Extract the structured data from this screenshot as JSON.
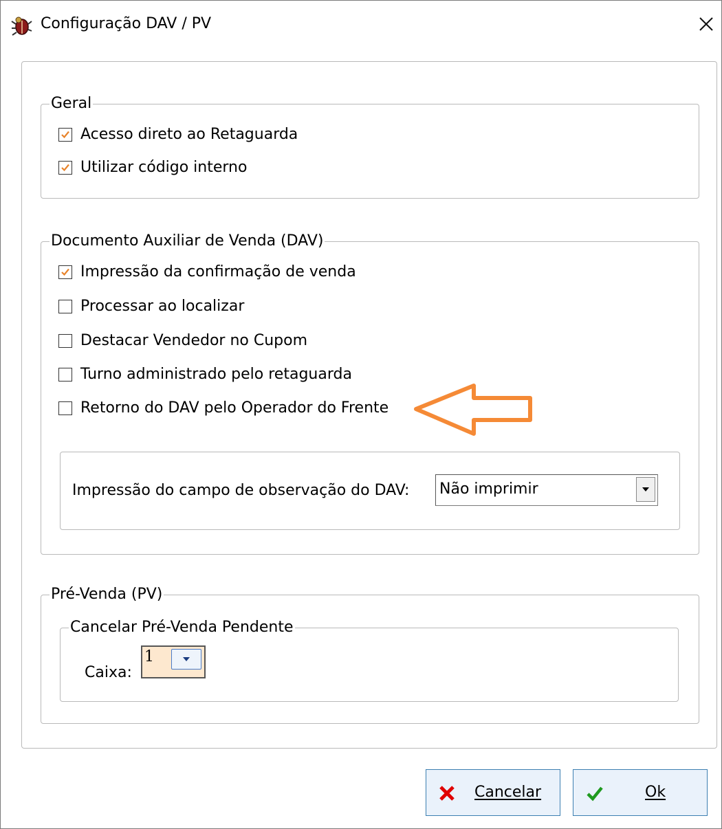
{
  "window": {
    "title": "Configuração DAV / PV",
    "app_icon": "bug-app-icon",
    "close_icon": "close-icon"
  },
  "geral": {
    "legend": "Geral",
    "items": [
      {
        "label": "Acesso direto ao Retaguarda",
        "checked": true
      },
      {
        "label": "Utilizar código interno",
        "checked": true
      }
    ]
  },
  "dav": {
    "legend": "Documento Auxiliar de Venda (DAV)",
    "items": [
      {
        "label": "Impressão da confirmação de venda",
        "checked": true
      },
      {
        "label": "Processar ao localizar",
        "checked": false
      },
      {
        "label": "Destacar Vendedor no Cupom",
        "checked": false
      },
      {
        "label": "Turno administrado pelo retaguarda",
        "checked": false
      },
      {
        "label": "Retorno do DAV pelo Operador do Frente",
        "checked": false
      }
    ],
    "obs_label": "Impressão do campo de observação do DAV:",
    "obs_value": "Não imprimir"
  },
  "pv": {
    "legend": "Pré-Venda (PV)",
    "cancel_legend": "Cancelar Pré-Venda Pendente",
    "caixa_label": "Caixa:",
    "caixa_value": "1"
  },
  "buttons": {
    "cancel_label": "Cancelar",
    "ok_label": "Ok"
  },
  "colors": {
    "check_accent": "#e8832a",
    "arrow_annotation": "#f58a36",
    "cancel_icon": "#e00000",
    "ok_icon": "#1f9a1f"
  }
}
